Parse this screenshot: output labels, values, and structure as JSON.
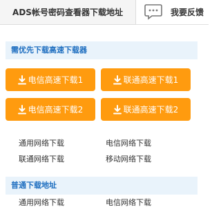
{
  "tabs": {
    "active_title": "ADS帐号密码查看器下载地址",
    "feedback_label": "我要反馈",
    "feedback_icon": "chat-bubble-icon"
  },
  "priority_section": {
    "title": "需优先下载高速下载器",
    "buttons": [
      {
        "label": "电信高速下载1",
        "icon": "download-icon"
      },
      {
        "label": "联通高速下载1",
        "icon": "download-icon"
      },
      {
        "label": "电信高速下载2",
        "icon": "download-icon"
      },
      {
        "label": "联通高速下载2",
        "icon": "download-icon"
      }
    ],
    "links": [
      "通用网络下载",
      "电信网络下载",
      "联通网络下载",
      "移动网络下载"
    ]
  },
  "normal_section": {
    "title": "普通下载地址",
    "links": [
      "通用网络下载",
      "电信网络下载"
    ]
  },
  "colors": {
    "button_orange": "#ff9b0f",
    "section_title_blue": "#1f6fc0",
    "section_bg": "#e9f3fb"
  }
}
